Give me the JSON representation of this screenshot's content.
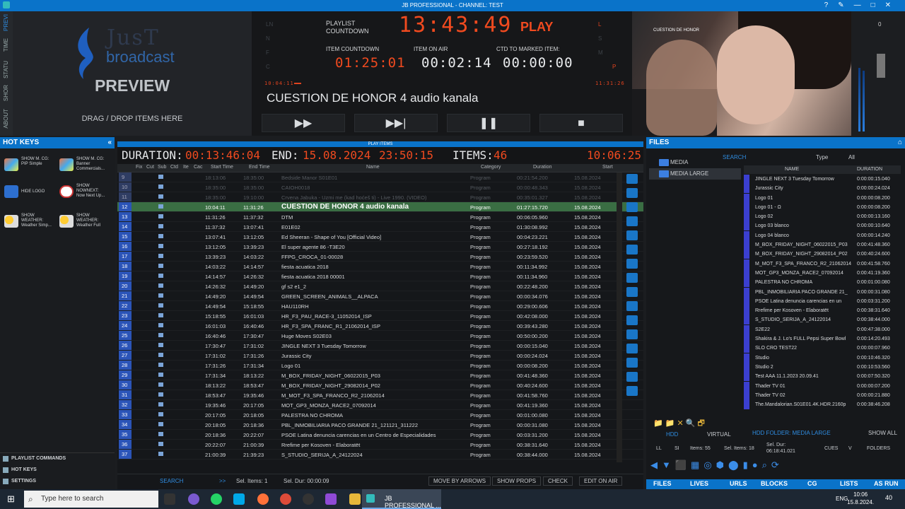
{
  "window": {
    "title": "JB PROFESSIONAL - CHANNEL: TEST"
  },
  "vtabs": [
    "PREVI",
    "TIME",
    "STATU",
    "SHOR",
    "ABOUT"
  ],
  "preview": {
    "logo_just": "JusT",
    "logo_broadcast": "broadcast",
    "title": "PREVIEW",
    "drag": "DRAG / DROP ITEMS HERE"
  },
  "countdown": {
    "playlist_label1": "PLAYLIST",
    "playlist_label2": "COUNTDOWN",
    "playlist_time": "13:43:49",
    "play": "PLAY",
    "item_countdown_label": "ITEM COUNTDOWN",
    "item_countdown": "01:25:01",
    "item_on_air_label": "ITEM ON AIR",
    "item_on_air": "00:02:14",
    "ctd_label": "CTD TO MARKED ITEM:",
    "ctd": "00:00:00",
    "small_left": "10:04:11",
    "small_right": "11:31:26",
    "item_name": "CUESTION DE HONOR 4 audio kanala",
    "dim_left": [
      "LN",
      "N",
      "F",
      "C"
    ],
    "dim_right": [
      "L",
      "S",
      "M",
      "P"
    ]
  },
  "video": {
    "caption": "CUESTION DE HONOR"
  },
  "meter": {
    "value": "0"
  },
  "hotkeys": {
    "title": "HOT KEYS",
    "buttons": [
      {
        "l1": "SHOW M. CG:",
        "l2": "PIP Simple",
        "l3": ""
      },
      {
        "l1": "SHOW M. CG:",
        "l2": "Banner",
        "l3": "Commercials..."
      },
      {
        "l1": "HIDE LOGO",
        "l2": "",
        "l3": ""
      },
      {
        "l1": "SHOW",
        "l2": "NOWNEXT:",
        "l3": "Now Next Up..."
      },
      {
        "l1": "SHOW",
        "l2": "WEATHER:",
        "l3": "Weather Simp..."
      },
      {
        "l1": "SHOW",
        "l2": "WEATHER:",
        "l3": "Weather Full"
      }
    ],
    "footer": [
      "PLAYLIST COMMANDS",
      "HOT KEYS",
      "SETTINGS"
    ]
  },
  "playlist": {
    "header": "PLAY ITEMS",
    "duration_label": "DURATION:",
    "duration": "00:13:46:04",
    "end_label": "END:",
    "end_date": "15.08.2024",
    "end_time": "23:50:15",
    "items_label": "ITEMS:",
    "items": "46",
    "clock": "10:06:25",
    "columns": [
      "Fix",
      "Cut",
      "Sub",
      "Ctd",
      "Ite",
      "Cac",
      "Start Time",
      "End Time",
      "Name",
      "Category",
      "Duration",
      "Start"
    ],
    "rows": [
      [
        "9",
        "18:13:06",
        "18:35:00",
        "Bedside Manor S01E01",
        "Program",
        "00:21:54.200",
        "15.08.2024",
        "past"
      ],
      [
        "10",
        "18:35:00",
        "18:35:00",
        "CAIOH0018",
        "Program",
        "00:00:48.343",
        "15.08.2024",
        "past"
      ],
      [
        "11",
        "18:35:00",
        "19:10:00",
        "Crvena Jabuka - Uzmi me (kad hoćeš ti) - Live 1990. (VIDEO)",
        "Program",
        "00:35:01.327",
        "15.08.2024",
        "past"
      ],
      [
        "12",
        "10:04:11",
        "11:31:26",
        "CUESTION DE HONOR 4 audio kanala",
        "Program",
        "01:27:15.720",
        "15.08.2024",
        "cur"
      ],
      [
        "13",
        "11:31:26",
        "11:37:32",
        "DTM",
        "Program",
        "00:06:05.960",
        "15.08.2024",
        ""
      ],
      [
        "14",
        "11:37:32",
        "13:07:41",
        "E01E02",
        "Program",
        "01:30:08.992",
        "15.08.2024",
        ""
      ],
      [
        "15",
        "13:07:41",
        "13:12:05",
        "Ed Sheeran - Shape of You [Official Video]",
        "Program",
        "00:04:23.221",
        "15.08.2024",
        ""
      ],
      [
        "16",
        "13:12:05",
        "13:39:23",
        "El super agente 86 -T3E20",
        "Program",
        "00:27:18.192",
        "15.08.2024",
        ""
      ],
      [
        "17",
        "13:39:23",
        "14:03:22",
        "FFPG_CROCA_01-00028",
        "Program",
        "00:23:59.520",
        "15.08.2024",
        ""
      ],
      [
        "18",
        "14:03:22",
        "14:14:57",
        "fiesta acuatica 2018",
        "Program",
        "00:11:34.992",
        "15.08.2024",
        ""
      ],
      [
        "19",
        "14:14:57",
        "14:26:32",
        "fiesta acuatica 2018 00001",
        "Program",
        "00:11:34.960",
        "15.08.2024",
        ""
      ],
      [
        "20",
        "14:26:32",
        "14:49:20",
        "gf s2 e1_2",
        "Program",
        "00:22:48.200",
        "15.08.2024",
        ""
      ],
      [
        "21",
        "14:49:20",
        "14:49:54",
        "GREEN_SCREEN_ANIMALS__ALPACA",
        "Program",
        "00:00:34.076",
        "15.08.2024",
        ""
      ],
      [
        "22",
        "14:49:54",
        "15:18:55",
        "HAU110RH",
        "Program",
        "00:29:00.606",
        "15.08.2024",
        ""
      ],
      [
        "23",
        "15:18:55",
        "16:01:03",
        "HR_F3_PAU_RACE-3_11052014_ISP",
        "Program",
        "00:42:08.000",
        "15.08.2024",
        ""
      ],
      [
        "24",
        "16:01:03",
        "16:40:46",
        "HR_F3_SPA_FRANC_R1_21062014_ISP",
        "Program",
        "00:39:43.280",
        "15.08.2024",
        ""
      ],
      [
        "25",
        "16:40:46",
        "17:30:47",
        "Huge Moves S02E03",
        "Program",
        "00:50:00.200",
        "15.08.2024",
        ""
      ],
      [
        "26",
        "17:30:47",
        "17:31:02",
        "JINGLE NEXT 3 Tuesday Tomorrow",
        "Program",
        "00:00:15.040",
        "15.08.2024",
        ""
      ],
      [
        "27",
        "17:31:02",
        "17:31:26",
        "Jurassic City",
        "Program",
        "00:00:24.024",
        "15.08.2024",
        ""
      ],
      [
        "28",
        "17:31:26",
        "17:31:34",
        "Logo 01",
        "Program",
        "00:00:08.200",
        "15.08.2024",
        ""
      ],
      [
        "29",
        "17:31:34",
        "18:13:22",
        "M_BOX_FRIDAY_NIGHT_06022015_P03",
        "Program",
        "00:41:48.360",
        "15.08.2024",
        ""
      ],
      [
        "30",
        "18:13:22",
        "18:53:47",
        "M_BOX_FRIDAY_NIGHT_29082014_P02",
        "Program",
        "00:40:24.600",
        "15.08.2024",
        ""
      ],
      [
        "31",
        "18:53:47",
        "19:35:46",
        "M_MOT_F3_SPA_FRANCO_R2_21062014",
        "Program",
        "00:41:58.760",
        "15.08.2024",
        ""
      ],
      [
        "32",
        "19:35:46",
        "20:17:05",
        "MOT_GP3_MONZA_RACE2_07092014",
        "Program",
        "00:41:19.360",
        "15.08.2024",
        ""
      ],
      [
        "33",
        "20:17:05",
        "20:18:05",
        "PALESTRA NO CHROMA",
        "Program",
        "00:01:00.080",
        "15.08.2024",
        ""
      ],
      [
        "34",
        "20:18:05",
        "20:18:36",
        "PBL_INMOBILIARIA PACO GRANDE 21_121121_311222",
        "Program",
        "00:00:31.080",
        "15.08.2024",
        ""
      ],
      [
        "35",
        "20:18:36",
        "20:22:07",
        "PSOE Latina denuncia carencias en un Centro de Especialidades",
        "Program",
        "00:03:31.200",
        "15.08.2024",
        ""
      ],
      [
        "36",
        "20:22:07",
        "21:00:39",
        "Rrefime per Kosoven - Elaboratët",
        "Program",
        "00:38:31.640",
        "15.08.2024",
        ""
      ],
      [
        "37",
        "21:00:39",
        "21:39:23",
        "S_STUDIO_SERIJA_A_24122024",
        "Program",
        "00:38:44.000",
        "15.08.2024",
        ""
      ]
    ],
    "bottom": {
      "search": "SEARCH",
      "arrows": ">>",
      "sel_items": "Sel. Items: 1",
      "sel_dur": "Sel. Dur: 00:00:09",
      "move": "MOVE BY ARROWS",
      "props": "SHOW PROPS",
      "check": "CHECK",
      "edit": "EDIT ON AIR"
    }
  },
  "files": {
    "title": "FILES",
    "search": "SEARCH",
    "type_label": "Type",
    "type_value": "All",
    "tree": [
      "MEDIA",
      "MEDIA LARGE"
    ],
    "columns": [
      "NAME",
      "DURATION"
    ],
    "rows": [
      [
        "JINGLE NEXT 3 Tuesday Tomorrow",
        "0:00:00:15.040"
      ],
      [
        "Jurassic City",
        "0:00:00:24.024"
      ],
      [
        "Logo 01",
        "0:00:00:08.200"
      ],
      [
        "Logo 01 - Ω",
        "0:00:00:08.200"
      ],
      [
        "Logo 02",
        "0:00:00:13.160"
      ],
      [
        "Logo 03 blanco",
        "0:00:00:10.640"
      ],
      [
        "Logo 04 blanco",
        "0:00:00:14.240"
      ],
      [
        "M_BOX_FRIDAY_NIGHT_06022015_P03",
        "0:00:41:48.360"
      ],
      [
        "M_BOX_FRIDAY_NIGHT_29082014_P02",
        "0:00:40:24.600"
      ],
      [
        "M_MOT_F3_SPA_FRANCO_R2_21062014",
        "0:00:41:58.760"
      ],
      [
        "MOT_GP3_MONZA_RACE2_07092014",
        "0:00:41:19.360"
      ],
      [
        "PALESTRA NO CHROMA",
        "0:00:01:00.080"
      ],
      [
        "PBL_INMOBILIARIA PACO GRANDE 21_",
        "0:00:00:31.080"
      ],
      [
        "PSOE Latina denuncia carencias en un",
        "0:00:03:31.200"
      ],
      [
        "Rrefime per Kosoven - Elaboratët",
        "0:00:38:31.640"
      ],
      [
        "S_STUDIO_SERIJA_A_24122014",
        "0:00:38:44.000"
      ],
      [
        "S2E22",
        "0:00:47:38.000"
      ],
      [
        "Shakira & J. Lo's FULL Pepsi Super Bowl",
        "0:00:14:20.493"
      ],
      [
        "SLO CRO TEST22",
        "0:00:00:07.960"
      ],
      [
        "Studio",
        "0:00:10:46.320"
      ],
      [
        "Studio 2",
        "0:00:10:53.560"
      ],
      [
        "Test AAA 11.1.2023 20.09.41",
        "0:00:07:50.320"
      ],
      [
        "Thader TV 01",
        "0:00:00:07.200"
      ],
      [
        "Thader TV 02",
        "0:00:00:21.880"
      ],
      [
        "The.Mandalorian.S01E01.4K.HDR.2160p",
        "0:00:38:46.208"
      ]
    ],
    "hdd": "HDD",
    "virtual": "VIRTUAL",
    "hdd_folder": "HDD FOLDER: MEDIA LARGE",
    "show_all": "SHOW ALL",
    "stats": {
      "ll": "LL",
      "si": "SI",
      "items": "Items: 55",
      "sel_items": "Sel. Items: 18",
      "sel_dur1": "Sel. Dur:",
      "sel_dur2": "06:18:41.021",
      "cues": "CUES",
      "v": "V",
      "folders": "FOLDERS"
    },
    "tabs": [
      "FILES",
      "LIVES",
      "URLS",
      "BLOCKS",
      "CG",
      "LISTS",
      "AS RUN"
    ]
  },
  "taskbar": {
    "search": "Type here to search",
    "app": "JB PROFESSIONAL ...",
    "lang": "ENG",
    "time": "10:06",
    "date": "15.8.2024.",
    "notif": "40"
  }
}
